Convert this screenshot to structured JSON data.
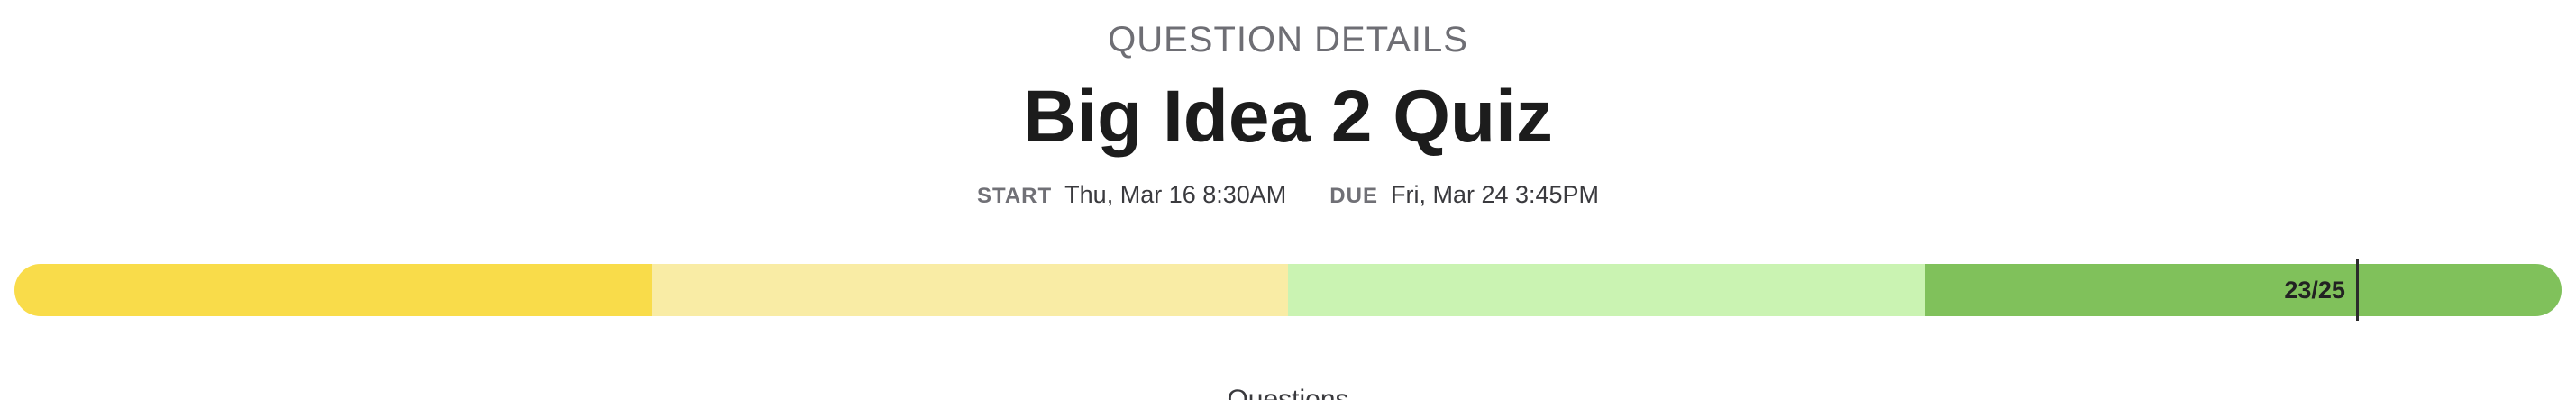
{
  "header": {
    "section_label": "QUESTION DETAILS",
    "title": "Big Idea 2 Quiz"
  },
  "dates": {
    "start_label": "START",
    "start_value": "Thu, Mar 16 8:30AM",
    "due_label": "DUE",
    "due_value": "Fri, Mar 24 3:45PM"
  },
  "score": {
    "label": "23/25",
    "earned": 23,
    "total": 25,
    "segment_colors": [
      "#f9dc4a",
      "#f9eca5",
      "#caf3b2",
      "#80c15b"
    ]
  },
  "questions": {
    "heading": "Questions"
  }
}
